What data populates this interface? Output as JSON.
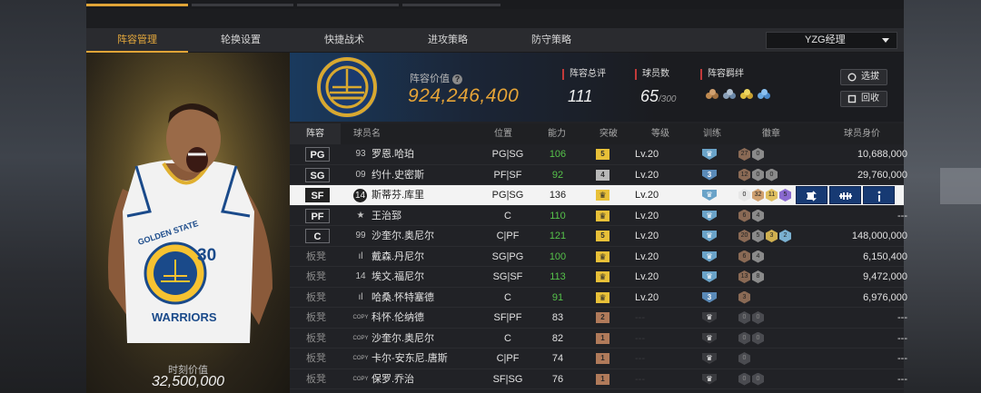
{
  "nav": {
    "tabs": [
      "阵容管理",
      "轮换设置",
      "快捷战术",
      "进攻策略",
      "防守策略"
    ],
    "active": 0,
    "team": "YZG经理"
  },
  "portrait": {
    "value_label": "时刻价值",
    "value": "32,500,000",
    "jersey_text": "GOLDEN STATE",
    "jersey_number": "30",
    "jersey_team": "WARRIORS"
  },
  "summary": {
    "value_label": "阵容价值",
    "value": "924,246,400",
    "rating_label": "阵容总评",
    "rating": "111",
    "count_label": "球员数",
    "count": "65",
    "count_max": "/300",
    "bond_label": "阵容羁绊",
    "select_btn": "选拔",
    "recycle_btn": "回收"
  },
  "table": {
    "headers": {
      "lineup": "阵容",
      "name": "球员名",
      "pos": "位置",
      "ability": "能力",
      "break": "突破",
      "level": "等级",
      "train": "训练",
      "badge": "徽章",
      "worth": "球员身价"
    },
    "rows": [
      {
        "slot": "PG",
        "num": "93",
        "name": "罗恩.哈珀",
        "pos": "PG|SG",
        "ability": "106",
        "ability_green": true,
        "break": "5",
        "break_type": "gold",
        "level": "Lv.20",
        "train": "",
        "train_color": "#6aa3c8",
        "badges": [
          {
            "t": "27",
            "c": "#8a6a55"
          },
          {
            "t": "0",
            "c": "#8a8a8a"
          }
        ],
        "worth": "10,688,000"
      },
      {
        "slot": "SG",
        "num": "09",
        "name": "约什.史密斯",
        "pos": "PF|SF",
        "ability": "92",
        "ability_green": true,
        "break": "4",
        "break_type": "silver",
        "level": "Lv.20",
        "train": "3",
        "train_color": "#5a8ab8",
        "badges": [
          {
            "t": "12",
            "c": "#8a6a55"
          },
          {
            "t": "0",
            "c": "#8a8a8a"
          },
          {
            "t": "0",
            "c": "#8a8a8a"
          }
        ],
        "worth": "29,760,000"
      },
      {
        "slot": "SF",
        "num": "14",
        "name": "斯蒂芬.库里",
        "pos": "PG|SG",
        "ability": "136",
        "ability_green": false,
        "break": "",
        "break_type": "crown",
        "level": "Lv.20",
        "train": "",
        "train_color": "#6aa3c8",
        "badges": [
          {
            "t": "0",
            "c": "#e8e8e8"
          },
          {
            "t": "32",
            "c": "#d0a070"
          },
          {
            "t": "11",
            "c": "#e0c060"
          },
          {
            "t": "5",
            "c": "#8a6ad0"
          }
        ],
        "worth": ""
      },
      {
        "slot": "PF",
        "num": "★",
        "name": "王治郅",
        "pos": "C",
        "ability": "110",
        "ability_green": true,
        "break": "",
        "break_type": "crown",
        "level": "Lv.20",
        "train": "",
        "train_color": "#6aa3c8",
        "badges": [
          {
            "t": "6",
            "c": "#8a6a55"
          },
          {
            "t": "4",
            "c": "#8a8a8a"
          }
        ],
        "worth": "---"
      },
      {
        "slot": "C",
        "num": "99",
        "name": "沙奎尔.奥尼尔",
        "pos": "C|PF",
        "ability": "121",
        "ability_green": true,
        "break": "5",
        "break_type": "gold",
        "level": "Lv.20",
        "train": "",
        "train_color": "#6aa3c8",
        "badges": [
          {
            "t": "20",
            "c": "#8a6a55"
          },
          {
            "t": "5",
            "c": "#8a8a8a"
          },
          {
            "t": "3",
            "c": "#d0b050"
          },
          {
            "t": "2",
            "c": "#7ab0d0"
          }
        ],
        "worth": "148,000,000"
      },
      {
        "slot": "板凳",
        "num": "ıl",
        "name": "戴森.丹尼尔",
        "pos": "SG|PG",
        "ability": "100",
        "ability_green": true,
        "break": "",
        "break_type": "crown",
        "level": "Lv.20",
        "train": "",
        "train_color": "#6aa3c8",
        "badges": [
          {
            "t": "6",
            "c": "#8a6a55"
          },
          {
            "t": "4",
            "c": "#8a8a8a"
          }
        ],
        "worth": "6,150,400"
      },
      {
        "slot": "板凳",
        "num": "14",
        "name": "埃文.福尼尔",
        "pos": "SG|SF",
        "ability": "113",
        "ability_green": true,
        "break": "",
        "break_type": "crown",
        "level": "Lv.20",
        "train": "",
        "train_color": "#6aa3c8",
        "badges": [
          {
            "t": "13",
            "c": "#8a6a55"
          },
          {
            "t": "8",
            "c": "#8a8a8a"
          }
        ],
        "worth": "9,472,000"
      },
      {
        "slot": "板凳",
        "num": "ıl",
        "name": "哈桑.怀特塞德",
        "pos": "C",
        "ability": "91",
        "ability_green": true,
        "break": "",
        "break_type": "crown",
        "level": "Lv.20",
        "train": "3",
        "train_color": "#5a8ab8",
        "badges": [
          {
            "t": "3",
            "c": "#8a6a55"
          }
        ],
        "worth": "6,976,000"
      },
      {
        "slot": "板凳",
        "num": "COPY",
        "name": "科怀.伦纳德",
        "pos": "SF|PF",
        "ability": "83",
        "ability_green": false,
        "break": "2",
        "break_type": "bronze",
        "level": "---",
        "train": "",
        "train_color": "#3a3b3f",
        "badges": [
          {
            "t": "0",
            "c": "#4a4b50"
          },
          {
            "t": "0",
            "c": "#4a4b50"
          }
        ],
        "worth": "---"
      },
      {
        "slot": "板凳",
        "num": "COPY",
        "name": "沙奎尔.奥尼尔",
        "pos": "C",
        "ability": "82",
        "ability_green": false,
        "break": "1",
        "break_type": "bronze",
        "level": "---",
        "train": "",
        "train_color": "#3a3b3f",
        "badges": [
          {
            "t": "0",
            "c": "#4a4b50"
          },
          {
            "t": "0",
            "c": "#4a4b50"
          }
        ],
        "worth": "---"
      },
      {
        "slot": "板凳",
        "num": "COPY",
        "name": "卡尔-安东尼.唐斯",
        "pos": "C|PF",
        "ability": "74",
        "ability_green": false,
        "break": "1",
        "break_type": "bronze",
        "level": "---",
        "train": "",
        "train_color": "#3a3b3f",
        "badges": [
          {
            "t": "0",
            "c": "#4a4b50"
          }
        ],
        "worth": "---"
      },
      {
        "slot": "板凳",
        "num": "COPY",
        "name": "保罗.乔治",
        "pos": "SF|SG",
        "ability": "76",
        "ability_green": false,
        "break": "1",
        "break_type": "bronze",
        "level": "---",
        "train": "",
        "train_color": "#3a3b3f",
        "badges": [
          {
            "t": "0",
            "c": "#4a4b50"
          },
          {
            "t": "0",
            "c": "#4a4b50"
          }
        ],
        "worth": "---"
      }
    ]
  },
  "colors": {
    "accent": "#e0a437",
    "green": "#56c24a",
    "selected_row": "#f3f3f3",
    "action_btn": "#173a73"
  }
}
